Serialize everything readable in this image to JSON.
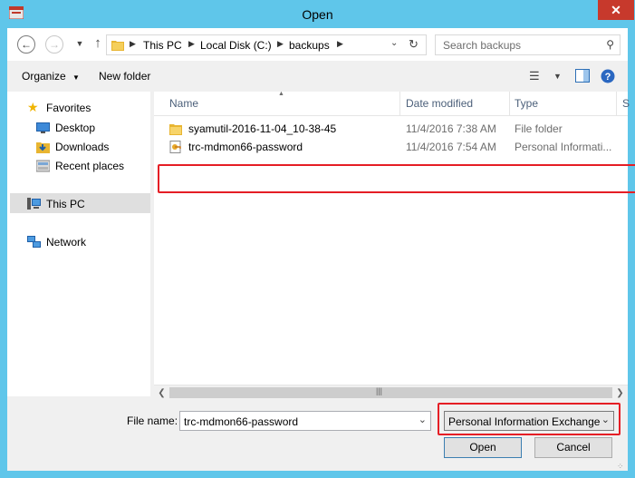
{
  "window": {
    "title": "Open",
    "close_label": "✕"
  },
  "address": {
    "crumbs": [
      "This PC",
      "Local Disk (C:)",
      "backups"
    ],
    "search_placeholder": "Search backups"
  },
  "toolbar": {
    "organize_label": "Organize",
    "new_folder_label": "New folder"
  },
  "nav": {
    "favorites": "Favorites",
    "desktop": "Desktop",
    "downloads": "Downloads",
    "recent": "Recent places",
    "this_pc": "This PC",
    "network": "Network"
  },
  "columns": {
    "name": "Name",
    "date_modified": "Date modified",
    "type": "Type",
    "size_partial": "S"
  },
  "files": [
    {
      "name": "syamutil-2016-11-04_10-38-45",
      "date": "11/4/2016 7:38 AM",
      "type": "File folder",
      "icon": "folder-icon"
    },
    {
      "name": "trc-mdmon66-password",
      "date": "11/4/2016 7:54 AM",
      "type": "Personal Informati...",
      "icon": "pfx-certificate-icon"
    }
  ],
  "bottom": {
    "filename_label": "File name:",
    "filename_value": "trc-mdmon66-password",
    "filetype_value": "Personal Information Exchange",
    "open_label": "Open",
    "cancel_label": "Cancel"
  },
  "colors": {
    "titlebar": "#5fc6ea",
    "close": "#c7392c",
    "highlight": "#e51e25",
    "header_text": "#4c607a"
  }
}
